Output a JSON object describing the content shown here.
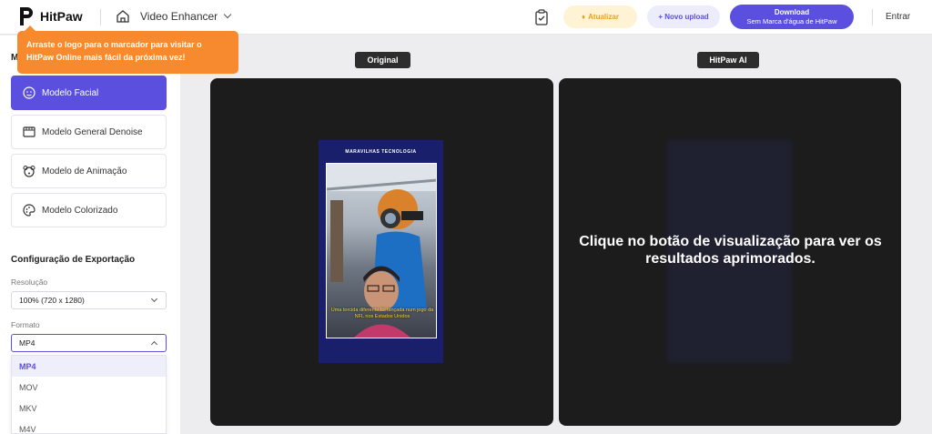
{
  "header": {
    "brand": "HitPaw",
    "tool": "Video Enhancer",
    "upgrade": "Atualizar",
    "upload": "+ Novo upload",
    "download_title": "Download",
    "download_sub": "Sem Marca d'água de HitPaw",
    "login": "Entrar"
  },
  "tooltip": {
    "text": "Arraste o logo para o marcador para visitar o HitPaw Online mais fácil da próxima vez!"
  },
  "sidebar": {
    "title_partial": "M",
    "models": [
      {
        "label": "Modelo Facial",
        "icon": "face-icon",
        "active": true
      },
      {
        "label": "Modelo General Denoise",
        "icon": "film-icon",
        "active": false
      },
      {
        "label": "Modelo de Animação",
        "icon": "bear-icon",
        "active": false
      },
      {
        "label": "Modelo Colorizado",
        "icon": "palette-icon",
        "active": false
      }
    ],
    "export_title": "Configuração de Exportação",
    "resolution_label": "Resolução",
    "resolution_value": "100% (720 x 1280)",
    "format_label": "Formato",
    "format_value": "MP4",
    "format_options": [
      "MP4",
      "MOV",
      "MKV",
      "M4V"
    ]
  },
  "preview": {
    "original_label": "Original",
    "ai_label": "HitPaw AI",
    "video_title": "MARAVILHAS TECNOLOGIA",
    "subtitle": "Uma torcida diferente foi lançada num jogo da NFL nos Estados Unidos",
    "overlay_text": "Clique no botão de visualização para ver os resultados aprimorados."
  },
  "colors": {
    "accent": "#5b4fe0",
    "tooltip": "#f7892f",
    "upgrade_text": "#e8a317",
    "panel": "#1c1c1c"
  }
}
